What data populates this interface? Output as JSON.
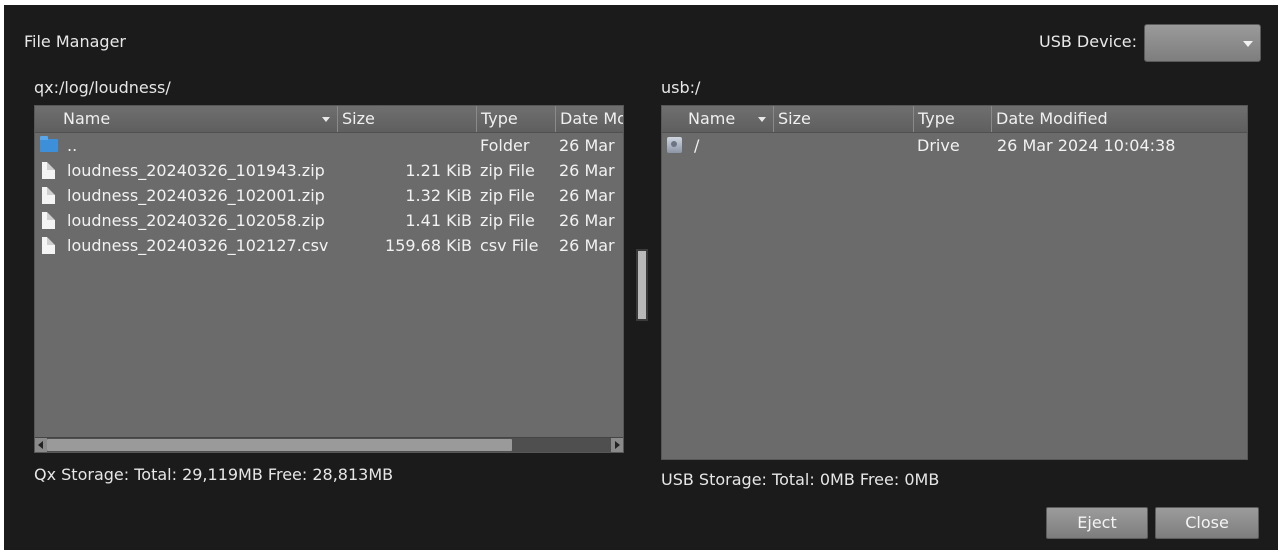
{
  "window": {
    "title": "File Manager",
    "usb_device_label": "USB Device:",
    "usb_device_value": ""
  },
  "left_pane": {
    "path": "qx:/log/loudness/",
    "columns": [
      "Name",
      "Size",
      "Type",
      "Date Mo"
    ],
    "rows": [
      {
        "icon": "folder-icon",
        "name": "..",
        "size": "",
        "type": "Folder",
        "date": "26 Mar"
      },
      {
        "icon": "file-icon",
        "name": "loudness_20240326_101943.zip",
        "size": "1.21 KiB",
        "type": "zip File",
        "date": "26 Mar"
      },
      {
        "icon": "file-icon",
        "name": "loudness_20240326_102001.zip",
        "size": "1.32 KiB",
        "type": "zip File",
        "date": "26 Mar"
      },
      {
        "icon": "file-icon",
        "name": "loudness_20240326_102058.zip",
        "size": "1.41 KiB",
        "type": "zip File",
        "date": "26 Mar"
      },
      {
        "icon": "file-icon",
        "name": "loudness_20240326_102127.csv",
        "size": "159.68 KiB",
        "type": "csv File",
        "date": "26 Mar"
      }
    ],
    "storage": "Qx Storage: Total: 29,119MB Free: 28,813MB"
  },
  "right_pane": {
    "path": "usb:/",
    "columns": [
      "Name",
      "Size",
      "Type",
      "Date Modified"
    ],
    "rows": [
      {
        "icon": "drive-icon",
        "name": "/",
        "size": "",
        "type": "Drive",
        "date": "26 Mar 2024 10:04:38"
      }
    ],
    "storage": "USB Storage: Total: 0MB Free: 0MB"
  },
  "buttons": {
    "eject": "Eject",
    "close": "Close"
  },
  "colors": {
    "window_bg": "#1b1b1b",
    "pane_bg": "#6b6b6b",
    "header_bg": "#636363",
    "folder_icon": "#3d8fd9",
    "button_bg": "#8c8c8c"
  }
}
